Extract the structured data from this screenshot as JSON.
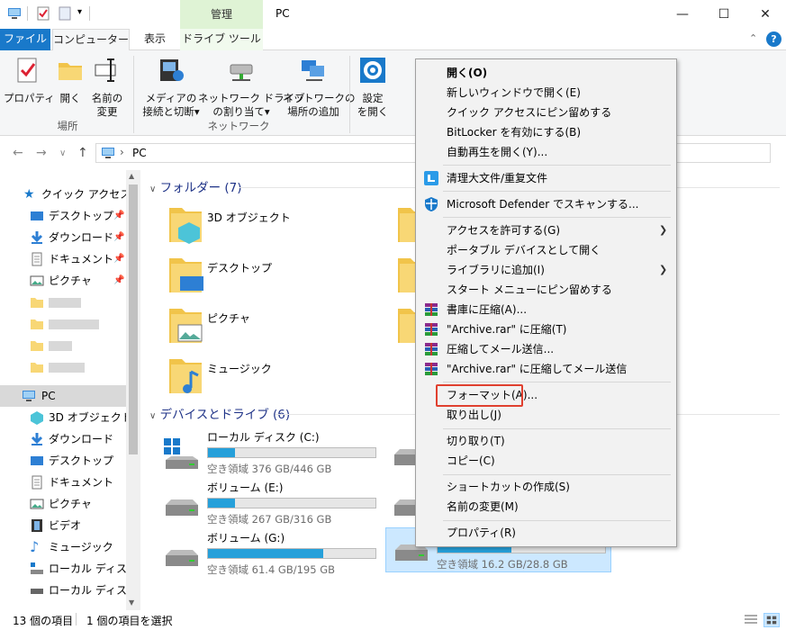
{
  "window": {
    "title": "PC",
    "ribbon_context_header": "管理"
  },
  "tabs": [
    {
      "label": "ファイル"
    },
    {
      "label": "コンピューター"
    },
    {
      "label": "表示"
    },
    {
      "label": "ドライブ ツール"
    }
  ],
  "ribbon": {
    "buttons": [
      {
        "label": "プロパティ"
      },
      {
        "label": "開く"
      },
      {
        "label": "名前の\n変更"
      },
      {
        "label": "メディアの\n接続と切断▾"
      },
      {
        "label": "ネットワーク ドライブ\nの割り当て▾"
      },
      {
        "label": "ネットワークの\n場所の追加"
      },
      {
        "label": "設定\nを開く"
      }
    ],
    "groups": [
      {
        "label": "場所"
      },
      {
        "label": "ネットワーク"
      }
    ]
  },
  "address": {
    "path": "PC"
  },
  "nav": {
    "quick_access": "クイック アクセス",
    "items": [
      {
        "label": "デスクトップ",
        "pinned": true
      },
      {
        "label": "ダウンロード",
        "pinned": true
      },
      {
        "label": "ドキュメント",
        "pinned": true
      },
      {
        "label": "ピクチャ",
        "pinned": true
      }
    ],
    "pc": "PC",
    "pc_items": [
      {
        "label": "3D オブジェクト"
      },
      {
        "label": "ダウンロード"
      },
      {
        "label": "デスクトップ"
      },
      {
        "label": "ドキュメント"
      },
      {
        "label": "ピクチャ"
      },
      {
        "label": "ビデオ"
      },
      {
        "label": "ミュージック"
      },
      {
        "label": "ローカル ディスク (C"
      },
      {
        "label": "ローカル ディスク (D"
      }
    ]
  },
  "content": {
    "folders_header": "フォルダー (7)",
    "folders": [
      {
        "name": "3D オブジェクト"
      },
      {
        "name": "デスクトップ"
      },
      {
        "name": "ピクチャ"
      },
      {
        "name": "ミュージック"
      }
    ],
    "drives_header": "デバイスとドライブ (6)",
    "drives": [
      {
        "name": "ローカル ディスク (C:)",
        "free": "空き領域 376 GB/446 GB",
        "used_fraction": 0.16
      },
      {
        "name": "ボリューム (E:)",
        "free": "空き領域 267 GB/316 GB",
        "used_fraction": 0.16
      },
      {
        "name": "ボリューム (G:)",
        "free": "空き領域 61.4 GB/195 GB",
        "used_fraction": 0.69
      },
      {
        "name": "",
        "free": "空き領域 16.2 GB/28.8 GB",
        "used_fraction": 0.44
      }
    ]
  },
  "status": {
    "count": "13 個の項目",
    "selected": "1 個の項目を選択"
  },
  "context_menu": {
    "items": [
      {
        "label": "開く(O)",
        "bold": true
      },
      {
        "label": "新しいウィンドウで開く(E)"
      },
      {
        "label": "クイック アクセスにピン留めする"
      },
      {
        "label": "BitLocker を有効にする(B)"
      },
      {
        "label": "自動再生を開く(Y)..."
      },
      {
        "label": "清理大文件/重复文件"
      },
      {
        "label": "Microsoft Defender でスキャンする..."
      },
      {
        "label": "アクセスを許可する(G)"
      },
      {
        "label": "ポータブル デバイスとして開く"
      },
      {
        "label": "ライブラリに追加(I)"
      },
      {
        "label": "スタート メニューにピン留めする"
      },
      {
        "label": "書庫に圧縮(A)..."
      },
      {
        "label": "\"Archive.rar\" に圧縮(T)"
      },
      {
        "label": "圧縮してメール送信..."
      },
      {
        "label": "\"Archive.rar\" に圧縮してメール送信"
      },
      {
        "label": "フォーマット(A)..."
      },
      {
        "label": "取り出し(J)"
      },
      {
        "label": "切り取り(T)"
      },
      {
        "label": "コピー(C)"
      },
      {
        "label": "ショートカットの作成(S)"
      },
      {
        "label": "名前の変更(M)"
      },
      {
        "label": "プロパティ(R)"
      }
    ]
  },
  "colors": {
    "accent": "#1979ca",
    "header_text": "#1e3287",
    "highlight_border": "#e0402f",
    "drive_bar": "#26a0da"
  }
}
